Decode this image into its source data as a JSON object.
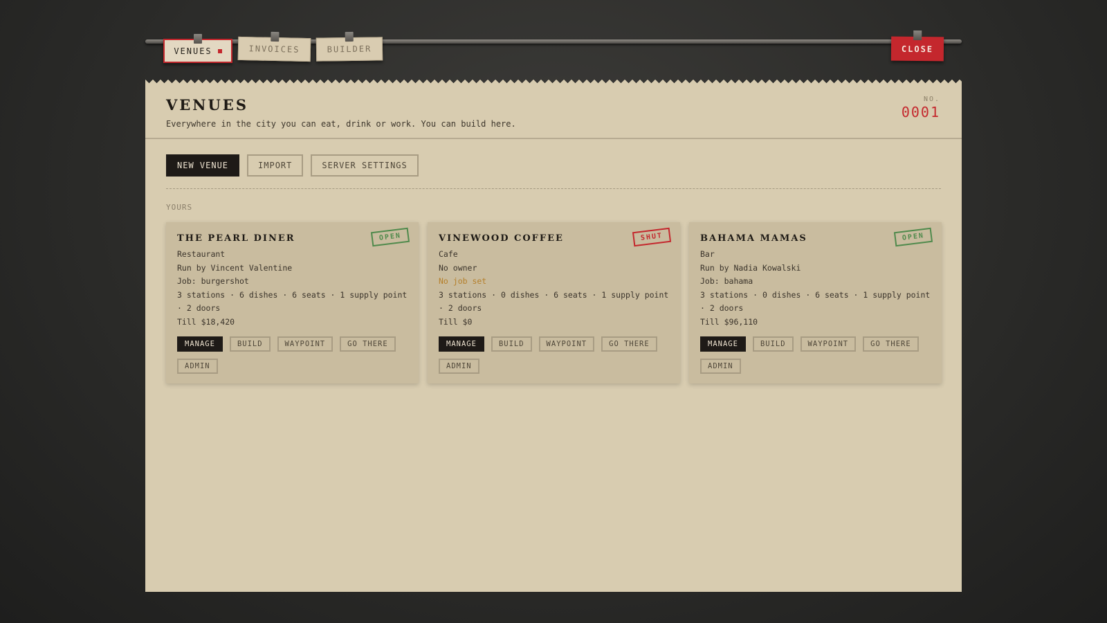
{
  "tabs": [
    {
      "label": "VENUES",
      "active": true
    },
    {
      "label": "INVOICES",
      "active": false
    },
    {
      "label": "BUILDER",
      "active": false
    }
  ],
  "close_label": "CLOSE",
  "header": {
    "title": "VENUES",
    "subtitle": "Everywhere in the city you can eat, drink or work. You can build here.",
    "no_label": "NO.",
    "no_value": "0001"
  },
  "toolbar": {
    "new_venue": "NEW VENUE",
    "import": "IMPORT",
    "server_settings": "SERVER SETTINGS"
  },
  "section_label": "YOURS",
  "venues": [
    {
      "name": "THE PEARL DINER",
      "status": "OPEN",
      "type": "Restaurant",
      "owner": "Run by Vincent Valentine",
      "job": "Job: burgershot",
      "stats": "3 stations · 6 dishes · 6 seats · 1 supply point · 2 doors",
      "till": "Till $18,420"
    },
    {
      "name": "VINEWOOD COFFEE",
      "status": "SHUT",
      "type": "Cafe",
      "owner": "No owner",
      "job": "No job set",
      "stats": "3 stations · 0 dishes · 6 seats · 1 supply point · 2 doors",
      "till": "Till $0"
    },
    {
      "name": "BAHAMA MAMAS",
      "status": "OPEN",
      "type": "Bar",
      "owner": "Run by Nadia Kowalski",
      "job": "Job: bahama",
      "stats": "3 stations · 0 dishes · 6 seats · 1 supply point · 2 doors",
      "till": "Till $96,110"
    }
  ],
  "card_actions": {
    "manage": "MANAGE",
    "build": "BUILD",
    "waypoint": "WAYPOINT",
    "go_there": "GO THERE",
    "admin": "ADMIN"
  },
  "colors": {
    "accent_red": "#c4272d",
    "open_green": "#4f8a4c",
    "paper": "#d8ccb0",
    "card": "#c9bc9f",
    "warning": "#b57f2a"
  }
}
